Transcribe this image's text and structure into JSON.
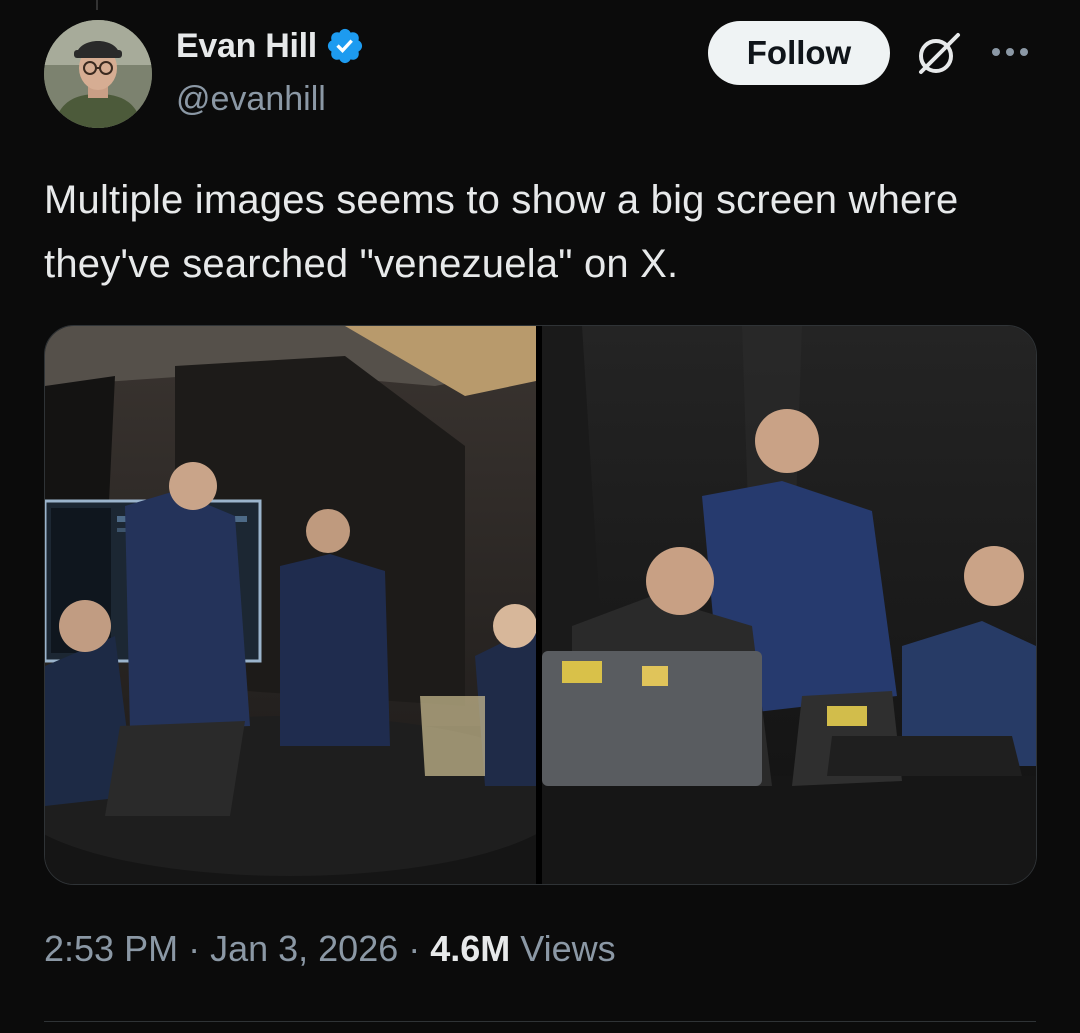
{
  "author": {
    "name": "Evan Hill",
    "handle": "@evanhill",
    "verified": true,
    "verified_color": "#1d9bf0"
  },
  "actions": {
    "follow_label": "Follow",
    "grok_icon": "grok-icon",
    "more_icon": "more-icon"
  },
  "tweet": {
    "text": "Multiple images seems to show a big screen where they've searched \"venezuela\" on X."
  },
  "media": {
    "count": 2
  },
  "meta": {
    "time": "2:53 PM",
    "separator": "·",
    "date": "Jan 3, 2026",
    "views_count": "4.6M",
    "views_label": "Views"
  },
  "colors": {
    "background": "#0b0b0b",
    "text": "#e7e9ea",
    "secondary": "#8b98a5",
    "follow_bg": "#eff3f4"
  }
}
